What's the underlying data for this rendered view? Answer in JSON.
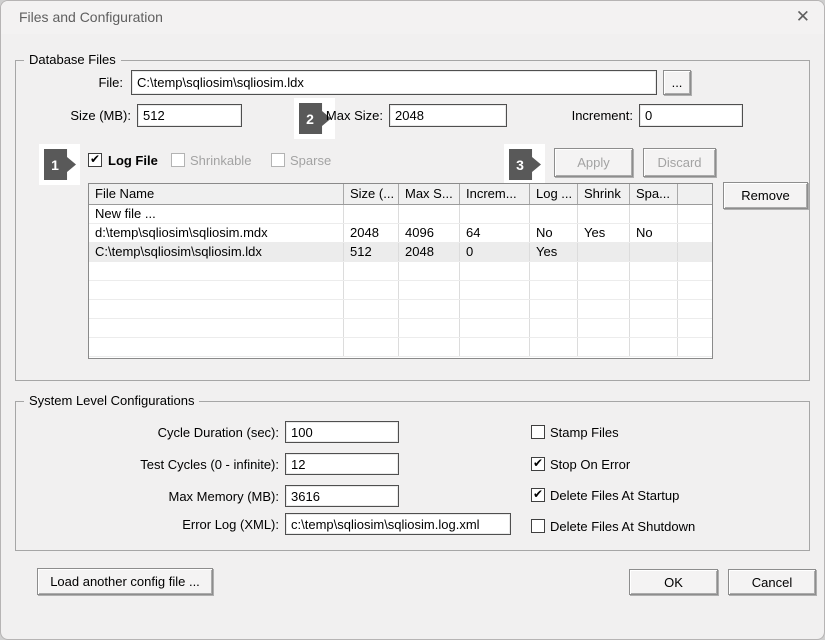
{
  "window": {
    "title": "Files and Configuration",
    "close_glyph": "✕"
  },
  "database_files": {
    "group_label": "Database Files",
    "file_label": "File:",
    "file_value": "C:\\temp\\sqliosim\\sqliosim.ldx",
    "browse_label": "...",
    "size_label": "Size (MB):",
    "size_value": "512",
    "max_size_label": "Max Size:",
    "max_size_value": "2048",
    "increment_label": "Increment:",
    "increment_value": "0",
    "log_file": {
      "label": "Log File",
      "mark": "✔"
    },
    "shrinkable": {
      "label": "Shrinkable",
      "mark": ""
    },
    "sparse": {
      "label": "Sparse",
      "mark": ""
    },
    "apply_label": "Apply",
    "discard_label": "Discard",
    "remove_label": "Remove",
    "badges": {
      "one": "1",
      "two": "2",
      "three": "3"
    },
    "table": {
      "columns": [
        "File Name",
        "Size (...",
        "Max S...",
        "Increm...",
        "Log ...",
        "Shrink",
        "Spa...",
        ""
      ],
      "rows": [
        {
          "file": "New file ...",
          "size": "",
          "max": "",
          "increment": "",
          "log": "",
          "shrink": "",
          "sparse": ""
        },
        {
          "file": "d:\\temp\\sqliosim\\sqliosim.mdx",
          "size": "2048",
          "max": "4096",
          "increment": "64",
          "log": "No",
          "shrink": "Yes",
          "sparse": "No"
        },
        {
          "file": "C:\\temp\\sqliosim\\sqliosim.ldx",
          "size": "512",
          "max": "2048",
          "increment": "0",
          "log": "Yes",
          "shrink": "",
          "sparse": ""
        }
      ]
    }
  },
  "system_config": {
    "group_label": "System Level Configurations",
    "cycle_label": "Cycle Duration (sec):",
    "cycle_value": "100",
    "test_label": "Test Cycles (0 - infinite):",
    "test_value": "12",
    "memory_label": "Max Memory (MB):",
    "memory_value": "3616",
    "errorlog_label": "Error Log (XML):",
    "errorlog_value": "c:\\temp\\sqliosim\\sqliosim.log.xml",
    "stamp": {
      "label": "Stamp Files",
      "mark": ""
    },
    "stop": {
      "label": "Stop On Error",
      "mark": "✔"
    },
    "delete_startup": {
      "label": "Delete Files At Startup",
      "mark": "✔"
    },
    "delete_shutdown": {
      "label": "Delete Files At Shutdown",
      "mark": ""
    }
  },
  "footer": {
    "load_label": "Load another config file ...",
    "ok_label": "OK",
    "cancel_label": "Cancel"
  }
}
